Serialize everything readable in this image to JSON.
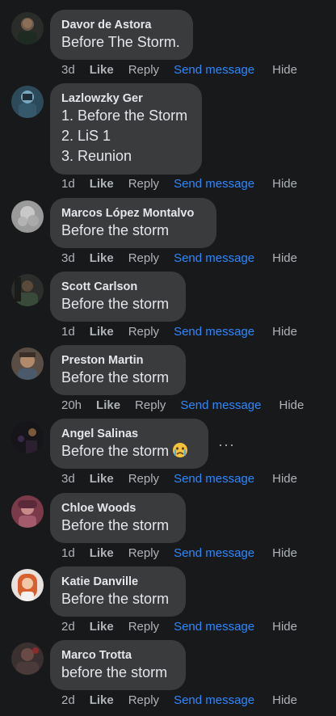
{
  "comments": [
    {
      "author": "Davor de Astora",
      "lines": [
        "Before The Storm."
      ],
      "time": "3d",
      "like": "Like",
      "reply": "Reply",
      "send": "Send message",
      "hide": "Hide"
    },
    {
      "author": "Lazlowzky Ger",
      "lines": [
        "1. Before the Storm",
        "2. LiS 1",
        "3. Reunion"
      ],
      "time": "1d",
      "like": "Like",
      "reply": "Reply",
      "send": "Send message",
      "hide": "Hide"
    },
    {
      "author": "Marcos López Montalvo",
      "lines": [
        "Before the storm"
      ],
      "time": "3d",
      "like": "Like",
      "reply": "Reply",
      "send": "Send message",
      "hide": "Hide"
    },
    {
      "author": "Scott Carlson",
      "lines": [
        "Before the storm"
      ],
      "time": "1d",
      "like": "Like",
      "reply": "Reply",
      "send": "Send message",
      "hide": "Hide"
    },
    {
      "author": "Preston Martin",
      "lines": [
        "Before the storm"
      ],
      "time": "20h",
      "like": "Like",
      "reply": "Reply",
      "send": "Send message",
      "hide": "Hide"
    },
    {
      "author": "Angel Salinas",
      "lines": [
        "Before the storm"
      ],
      "emoji": "crying-face-emoji",
      "more": "···",
      "time": "3d",
      "like": "Like",
      "reply": "Reply",
      "send": "Send message",
      "hide": "Hide"
    },
    {
      "author": "Chloe Woods",
      "lines": [
        "Before the storm"
      ],
      "time": "1d",
      "like": "Like",
      "reply": "Reply",
      "send": "Send message",
      "hide": "Hide"
    },
    {
      "author": "Katie Danville",
      "lines": [
        "Before the storm"
      ],
      "time": "2d",
      "like": "Like",
      "reply": "Reply",
      "send": "Send message",
      "hide": "Hide"
    },
    {
      "author": "Marco Trotta",
      "lines": [
        "before the storm"
      ],
      "time": "2d",
      "like": "Like",
      "reply": "Reply",
      "send": "Send message",
      "hide": "Hide"
    }
  ],
  "colors": {
    "background": "#18191a",
    "bubble": "#3a3b3c",
    "text": "#e4e6eb",
    "muted": "#b0b3b8",
    "link": "#2d88ff"
  }
}
